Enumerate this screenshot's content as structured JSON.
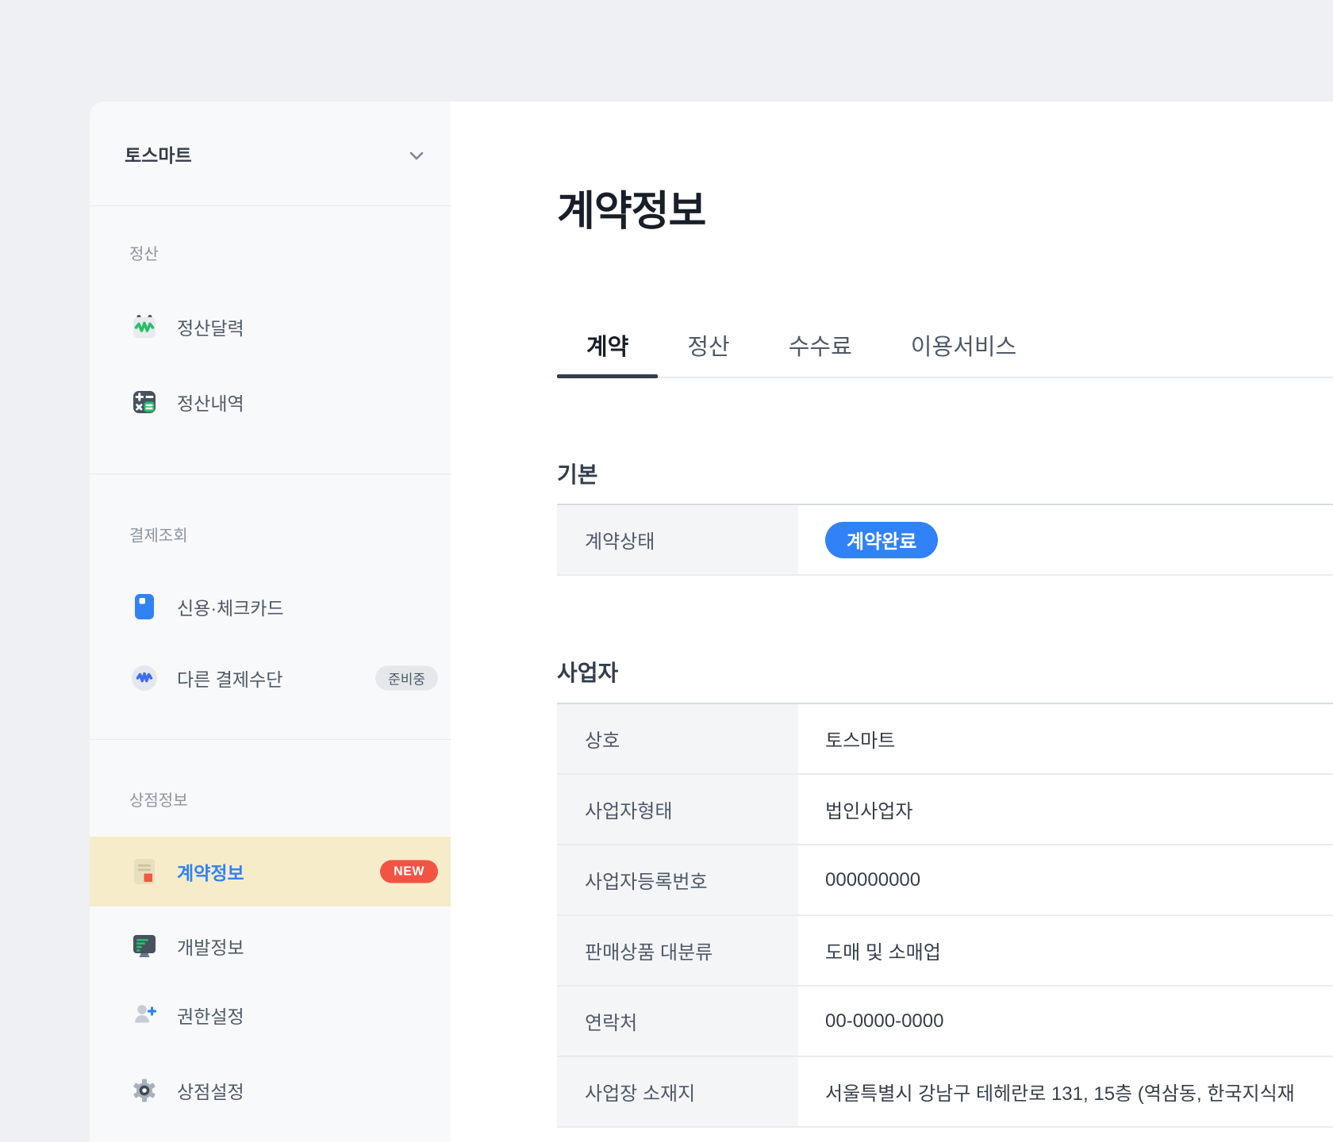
{
  "sidebar": {
    "merchant_name": "토스마트",
    "sections": [
      {
        "label": "정산",
        "items": [
          {
            "label": "정산달력",
            "icon": "settlement-calendar-icon"
          },
          {
            "label": "정산내역",
            "icon": "settlement-history-icon"
          }
        ]
      },
      {
        "label": "결제조회",
        "items": [
          {
            "label": "신용·체크카드",
            "icon": "credit-card-icon"
          },
          {
            "label": "다른 결제수단",
            "icon": "won-circle-icon",
            "badge": "준비중"
          }
        ]
      },
      {
        "label": "상점정보",
        "items": [
          {
            "label": "계약정보",
            "icon": "contract-doc-icon",
            "badge": "NEW",
            "active": true
          },
          {
            "label": "개발정보",
            "icon": "dev-monitor-icon"
          },
          {
            "label": "권한설정",
            "icon": "person-add-icon"
          },
          {
            "label": "상점설정",
            "icon": "gear-icon"
          }
        ]
      }
    ]
  },
  "main": {
    "title": "계약정보",
    "tabs": [
      {
        "label": "계약",
        "active": true
      },
      {
        "label": "정산"
      },
      {
        "label": "수수료"
      },
      {
        "label": "이용서비스"
      }
    ],
    "sections": [
      {
        "heading": "기본",
        "rows": [
          {
            "label": "계약상태",
            "badge": "계약완료"
          }
        ]
      },
      {
        "heading": "사업자",
        "rows": [
          {
            "label": "상호",
            "value": "토스마트"
          },
          {
            "label": "사업자형태",
            "value": "법인사업자"
          },
          {
            "label": "사업자등록번호",
            "value": "000000000"
          },
          {
            "label": "판매상품 대분류",
            "value": "도매 및 소매업"
          },
          {
            "label": "연락처",
            "value": "00-0000-0000"
          },
          {
            "label": "사업장 소재지",
            "value": "서울특별시 강남구 테헤란로 131, 15층 (역삼동, 한국지식재"
          }
        ]
      }
    ]
  },
  "colors": {
    "toss_blue": "#3182f6",
    "active_item_bg": "#f7ecca",
    "new_badge": "#f25444",
    "ready_badge_bg": "#e5e8eb",
    "green_accent": "#27c06a",
    "sidebar_bg": "#f8f9fa",
    "page_bg": "#eef0f3",
    "title_text": "#191f28"
  }
}
